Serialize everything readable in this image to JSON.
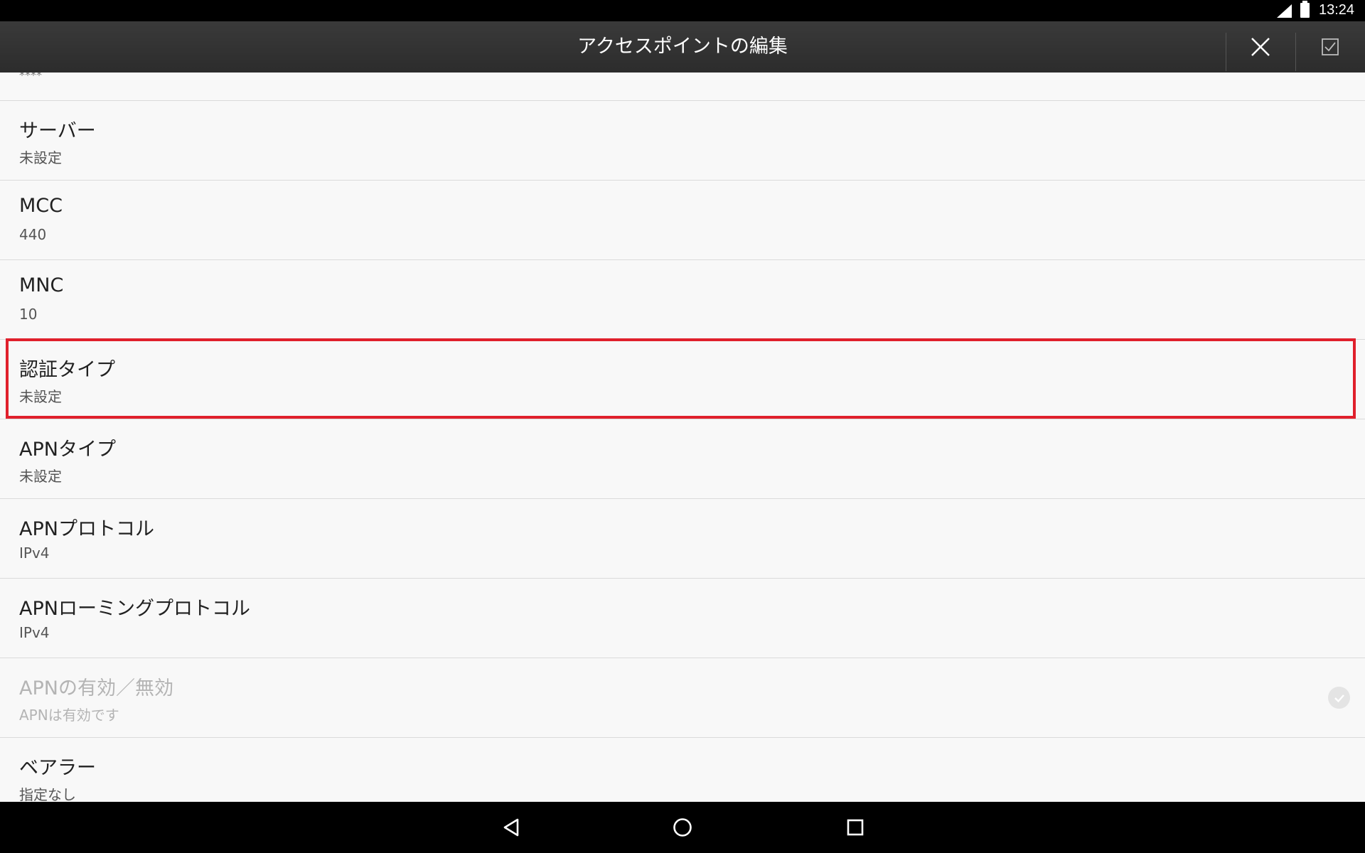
{
  "status_bar": {
    "time": "13:24",
    "icons": [
      "signal-icon",
      "battery-icon"
    ]
  },
  "action_bar": {
    "title": "アクセスポイントの編集",
    "actions": [
      "close-icon",
      "save-check-icon"
    ]
  },
  "settings": {
    "partial_summary": "****",
    "items": [
      {
        "label": "サーバー",
        "value": "未設定"
      },
      {
        "label": "MCC",
        "value": "440"
      },
      {
        "label": "MNC",
        "value": "10"
      },
      {
        "label": "認証タイプ",
        "value": "未設定"
      },
      {
        "label": "APNタイプ",
        "value": "未設定"
      },
      {
        "label": "APNプロトコル",
        "value": "IPv4"
      },
      {
        "label": "APNローミングプロトコル",
        "value": "IPv4"
      },
      {
        "label": "APNの有効／無効",
        "value": "APNは有効です",
        "enabled": false,
        "checked": true
      },
      {
        "label": "ベアラー",
        "value": "指定なし"
      }
    ],
    "highlighted_item": "認証タイプ",
    "highlight_color": "#e0202c"
  },
  "nav_bar": {
    "buttons": [
      "back-icon",
      "home-icon",
      "recents-icon"
    ]
  }
}
